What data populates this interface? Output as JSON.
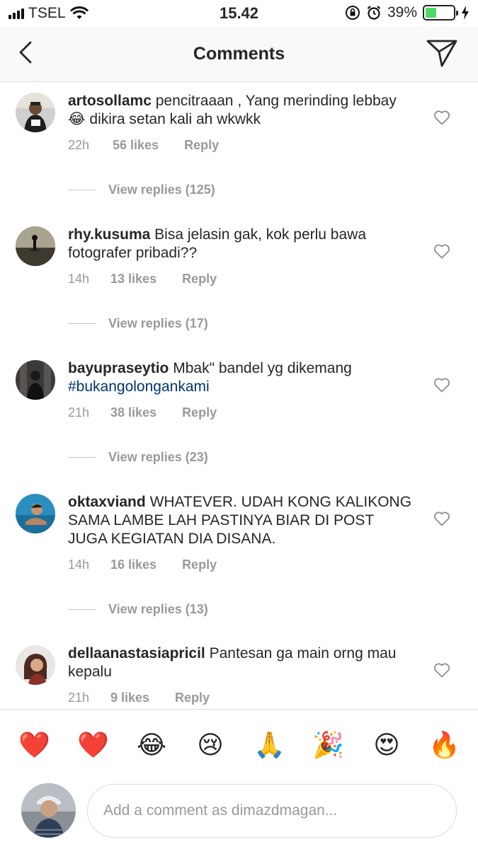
{
  "status_bar": {
    "carrier": "TSEL",
    "time": "15.42",
    "battery_percent": "39%",
    "battery_level": 0.39
  },
  "header": {
    "title": "Comments"
  },
  "comments": [
    {
      "username": "artosollamc",
      "text_before_emoji": "pencitraaan , Yang merinding lebbay",
      "emoji": "😂",
      "text_after_emoji": "dikira setan kali ah wkwkk",
      "time": "22h",
      "likes": "56 likes",
      "reply": "Reply",
      "view_replies": "View replies (125)"
    },
    {
      "username": "rhy.kusuma",
      "text": "Bisa jelasin gak, kok perlu bawa fotografer pribadi??",
      "time": "14h",
      "likes": "13 likes",
      "reply": "Reply",
      "view_replies": "View replies (17)"
    },
    {
      "username": "bayupraseytio",
      "text": "Mbak\" bandel yg dikemang",
      "hashtag": "#bukangolongankami",
      "time": "21h",
      "likes": "38 likes",
      "reply": "Reply",
      "view_replies": "View replies (23)"
    },
    {
      "username": "oktaxviand",
      "text": "WHATEVER. UDAH KONG KALIKONG SAMA LAMBE LAH PASTINYA BIAR DI POST JUGA KEGIATAN DIA DISANA.",
      "time": "14h",
      "likes": "16 likes",
      "reply": "Reply",
      "view_replies": "View replies (13)"
    },
    {
      "username": "dellaanastasiapricil",
      "text": "Pantesan ga main orng mau kepalu",
      "time": "21h",
      "likes": "9 likes",
      "reply": "Reply"
    }
  ],
  "emoji_bar": [
    "❤️",
    "❤️",
    "😂",
    "😢",
    "🙏",
    "🎉",
    "😍",
    "🔥"
  ],
  "compose": {
    "placeholder": "Add a comment as dimazdmagan..."
  },
  "colors": {
    "text": "#262626",
    "muted": "#999999",
    "hashtag": "#003569",
    "battery": "#4cd964",
    "divider": "#dbdbdb"
  }
}
